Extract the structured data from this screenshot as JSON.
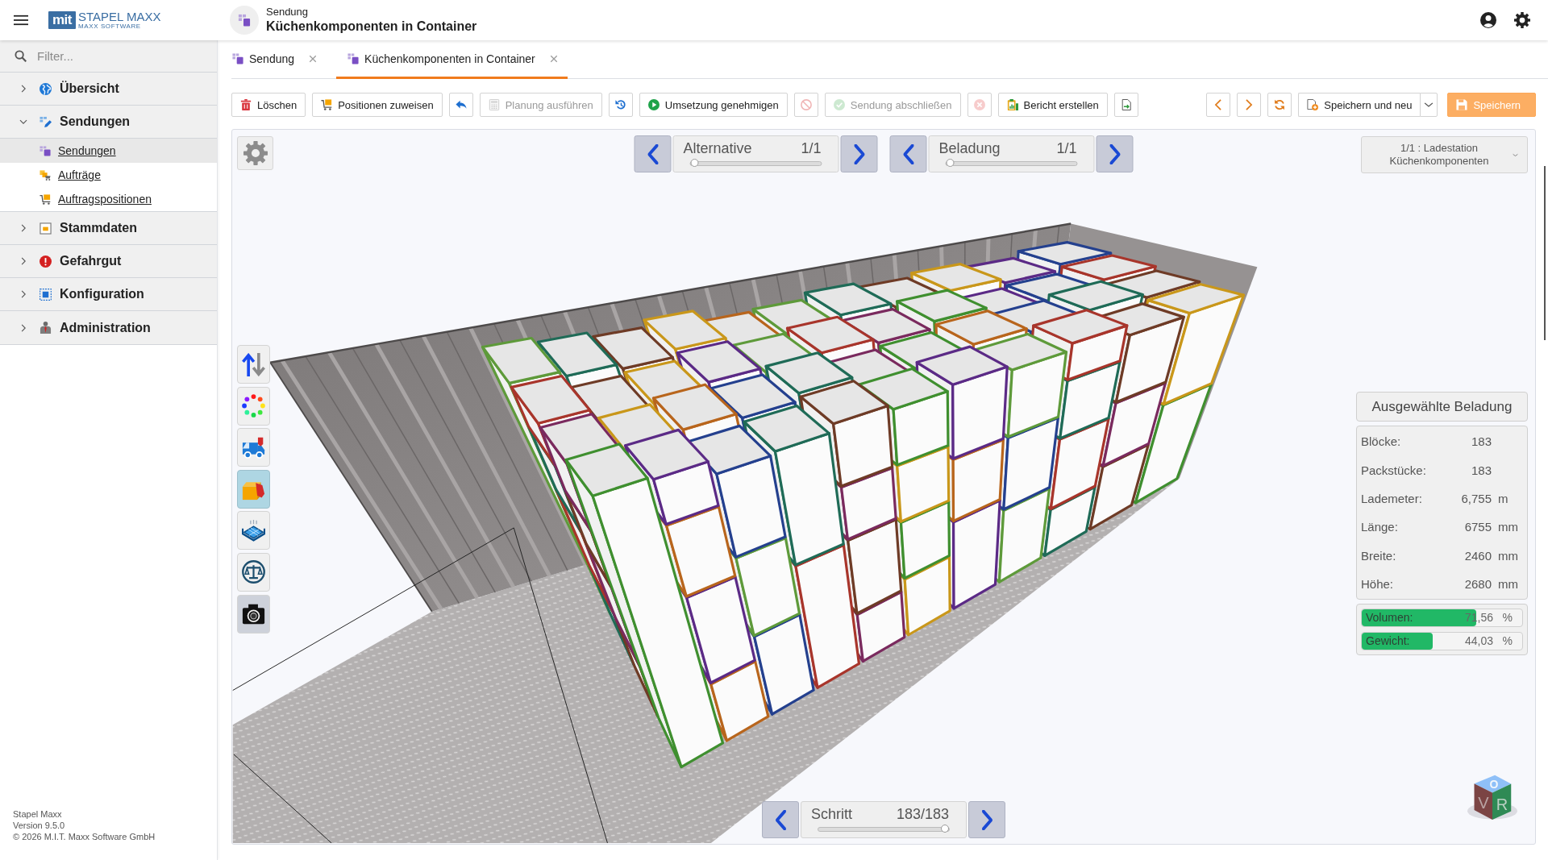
{
  "app": {
    "logo_mark": "mit",
    "name": "STAPEL MAXX",
    "tagline": "MAXX SOFTWARE"
  },
  "page": {
    "caption": "Sendung",
    "title": "Küchenkomponenten in Container"
  },
  "sidebar": {
    "filter": {
      "placeholder": "Filter..."
    },
    "items": [
      {
        "label": "Übersicht",
        "expanded": false
      },
      {
        "label": "Sendungen",
        "expanded": true,
        "children": [
          {
            "label": "Sendungen",
            "selected": true
          },
          {
            "label": "Aufträge",
            "selected": false
          },
          {
            "label": "Auftragspositionen",
            "selected": false
          }
        ]
      },
      {
        "label": "Stammdaten",
        "expanded": false
      },
      {
        "label": "Gefahrgut",
        "expanded": false
      },
      {
        "label": "Konfiguration",
        "expanded": false
      },
      {
        "label": "Administration",
        "expanded": false
      }
    ],
    "footer": [
      "Stapel Maxx",
      "Version 9.5.0",
      "© 2026 M.I.T. Maxx Software GmbH"
    ]
  },
  "tabs": [
    {
      "label": "Sendung",
      "selected": false
    },
    {
      "label": "Küchenkomponenten in Container",
      "selected": true
    }
  ],
  "toolbar": {
    "left": [
      {
        "kind": "button",
        "label": "Löschen",
        "disabled": false
      },
      {
        "kind": "button",
        "label": "Positionen zuweisen",
        "disabled": false
      },
      {
        "kind": "icon",
        "disabled": false
      },
      {
        "kind": "button",
        "label": "Planung ausführen",
        "disabled": true
      },
      {
        "kind": "icon",
        "disabled": false
      },
      {
        "kind": "button",
        "label": "Umsetzung genehmigen",
        "disabled": false
      },
      {
        "kind": "icon",
        "disabled": true
      },
      {
        "kind": "button",
        "label": "Sendung abschließen",
        "disabled": true
      },
      {
        "kind": "icon",
        "disabled": true
      },
      {
        "kind": "button",
        "label": "Bericht erstellen",
        "disabled": false
      },
      {
        "kind": "icon",
        "disabled": false
      }
    ],
    "right": [
      {
        "kind": "icon",
        "disabled": false
      },
      {
        "kind": "icon",
        "disabled": false
      },
      {
        "kind": "icon",
        "disabled": false
      },
      {
        "kind": "split",
        "label": "Speichern und neu",
        "disabled": false
      },
      {
        "kind": "primary",
        "label": "Speichern",
        "disabled": false
      }
    ]
  },
  "viewer": {
    "pickers": [
      {
        "label": "Alternative",
        "value": "1/1",
        "level": 0
      },
      {
        "label": "Beladung",
        "value": "1/1",
        "level": 0
      }
    ],
    "station": "1/1 : Ladestation Küchenkomponenten",
    "tools": [
      {
        "kind": "toggle",
        "selected": false
      },
      {
        "kind": "toggle",
        "selected": false
      },
      {
        "kind": "toggle",
        "selected": false
      },
      {
        "kind": "toggle",
        "selected": true
      },
      {
        "kind": "toggle",
        "selected": false
      },
      {
        "kind": "toggle",
        "selected": false
      },
      {
        "kind": "action",
        "selected": false
      }
    ],
    "summary": {
      "title": "Ausgewählte Beladung",
      "rows": [
        {
          "label": "Blöcke:",
          "value": "183"
        },
        {
          "label": "Packstücke:",
          "value": "183"
        },
        {
          "label": "Lademeter:",
          "value": "6,755",
          "unit": "m"
        },
        {
          "label": "Länge:",
          "value": "6755",
          "unit": "mm"
        },
        {
          "label": "Breite:",
          "value": "2460",
          "unit": "mm"
        },
        {
          "label": "Höhe:",
          "value": "2680",
          "unit": "mm"
        }
      ],
      "meters": [
        {
          "label": "Volumen:",
          "value": "71,56",
          "unit": "%",
          "level": 0.7156
        },
        {
          "label": "Gewicht:",
          "value": "44,03",
          "unit": "%",
          "level": 0.4403
        }
      ]
    },
    "step": {
      "label": "Schritt",
      "value": "183/183",
      "level": 1
    },
    "view_cube": {
      "faces": [
        "O",
        "V",
        "R"
      ]
    }
  }
}
